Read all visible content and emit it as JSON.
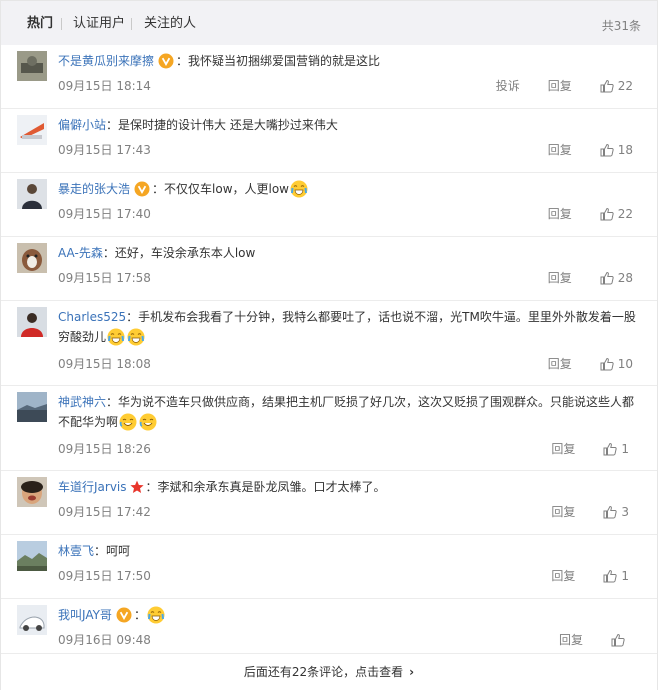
{
  "tabs": {
    "hot": "热门",
    "verified": "认证用户",
    "following": "关注的人",
    "total": "共31条"
  },
  "comments": [
    {
      "user": "不是黄瓜别来摩擦",
      "verified": true,
      "text": "：我怀疑当初捆绑爱国营销的就是这比",
      "time": "09月15日 18:14",
      "report": "投诉",
      "reply": "回复",
      "likes": "22"
    },
    {
      "user": "偏僻小站",
      "text": "：是保时捷的设计伟大 还是大嘴抄过来伟大",
      "time": "09月15日 17:43",
      "reply": "回复",
      "likes": "18"
    },
    {
      "user": "暴走的张大浩",
      "verified": true,
      "text": "：不仅仅车low，人更low",
      "time": "09月15日 17:40",
      "reply": "回复",
      "likes": "22"
    },
    {
      "user": "AA-先森",
      "text": "：还好，车没余承东本人low",
      "time": "09月15日 17:58",
      "reply": "回复",
      "likes": "28"
    },
    {
      "user": "Charles525",
      "text": "：手机发布会我看了十分钟，我特么都要吐了，话也说不溜，光TM吹牛逼。里里外外散发着一股穷酸劲儿",
      "time": "09月15日 18:08",
      "reply": "回复",
      "likes": "10"
    },
    {
      "user": "神武神六",
      "text": "：华为说不造车只做供应商，结果把主机厂贬损了好几次，这次又贬损了围观群众。只能说这些人都不配华为啊",
      "time": "09月15日 18:26",
      "reply": "回复",
      "likes": "1"
    },
    {
      "user": "车道行Jarvis",
      "star": true,
      "text": "：李斌和余承东真是卧龙凤雏。口才太棒了。",
      "time": "09月15日 17:42",
      "reply": "回复",
      "likes": "3"
    },
    {
      "user": "林壹飞",
      "text": "：呵呵",
      "time": "09月15日 17:50",
      "reply": "回复",
      "likes": "1"
    },
    {
      "user": "我叫JAY哥",
      "verified": true,
      "text": "：",
      "time": "09月16日 09:48",
      "reply": "回复",
      "likes": ""
    }
  ],
  "more": "后面还有22条评论，点击查看",
  "colors": {
    "nick": "#3b73b9",
    "vbadge": "#f5a623",
    "star": "#e8352b",
    "tabs_bg": "#f2f2f5"
  },
  "icons": {
    "verified": "verified-badge-icon",
    "like": "thumbs-up-icon",
    "emoji": "cry-laugh-emoji-icon",
    "star": "red-star-icon",
    "more": "chevron-right-icon"
  }
}
